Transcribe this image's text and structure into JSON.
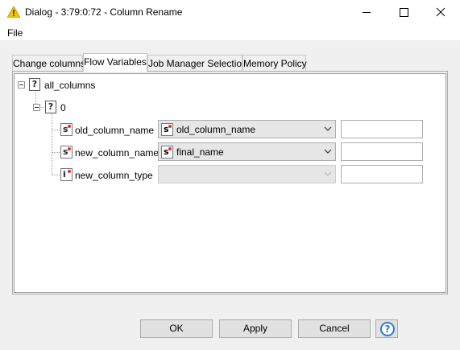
{
  "window": {
    "title": "Dialog - 3:79:0:72 - Column Rename",
    "icon": "warning-triangle-icon",
    "controls": [
      "minimize-icon",
      "maximize-icon",
      "close-icon"
    ]
  },
  "menu": {
    "file": "File"
  },
  "tabs": [
    {
      "label": "Change columns",
      "active": false
    },
    {
      "label": "Flow Variables",
      "active": true
    },
    {
      "label": "Job Manager Selection",
      "active": false
    },
    {
      "label": "Memory Policy",
      "active": false
    }
  ],
  "tree": {
    "root": {
      "label": "all_columns",
      "icon": "question-icon"
    },
    "group": {
      "label": "0",
      "icon": "question-icon"
    },
    "rows": [
      {
        "label": "old_column_name",
        "type_icon": "s",
        "selected": "old_column_name",
        "selected_icon": "s",
        "text_value": "",
        "disabled": false
      },
      {
        "label": "new_column_name",
        "type_icon": "s",
        "selected": "final_name",
        "selected_icon": "s",
        "text_value": "",
        "disabled": false
      },
      {
        "label": "new_column_type",
        "type_icon": "i",
        "selected": "",
        "selected_icon": "",
        "text_value": "",
        "disabled": true
      }
    ]
  },
  "buttons": {
    "ok": "OK",
    "apply": "Apply",
    "cancel": "Cancel",
    "help": "?"
  },
  "colors": {
    "accent": "#2b7bd4",
    "variable_dot": "#e03030",
    "warning_icon": "#f5c400"
  }
}
